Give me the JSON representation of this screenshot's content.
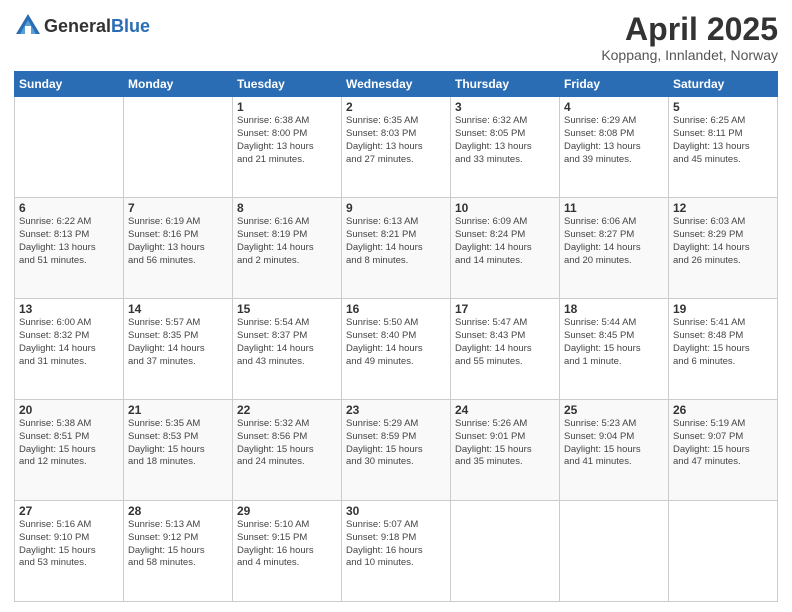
{
  "header": {
    "logo_general": "General",
    "logo_blue": "Blue",
    "title": "April 2025",
    "subtitle": "Koppang, Innlandet, Norway"
  },
  "days_of_week": [
    "Sunday",
    "Monday",
    "Tuesday",
    "Wednesday",
    "Thursday",
    "Friday",
    "Saturday"
  ],
  "weeks": [
    [
      {
        "day": "",
        "detail": ""
      },
      {
        "day": "",
        "detail": ""
      },
      {
        "day": "1",
        "detail": "Sunrise: 6:38 AM\nSunset: 8:00 PM\nDaylight: 13 hours\nand 21 minutes."
      },
      {
        "day": "2",
        "detail": "Sunrise: 6:35 AM\nSunset: 8:03 PM\nDaylight: 13 hours\nand 27 minutes."
      },
      {
        "day": "3",
        "detail": "Sunrise: 6:32 AM\nSunset: 8:05 PM\nDaylight: 13 hours\nand 33 minutes."
      },
      {
        "day": "4",
        "detail": "Sunrise: 6:29 AM\nSunset: 8:08 PM\nDaylight: 13 hours\nand 39 minutes."
      },
      {
        "day": "5",
        "detail": "Sunrise: 6:25 AM\nSunset: 8:11 PM\nDaylight: 13 hours\nand 45 minutes."
      }
    ],
    [
      {
        "day": "6",
        "detail": "Sunrise: 6:22 AM\nSunset: 8:13 PM\nDaylight: 13 hours\nand 51 minutes."
      },
      {
        "day": "7",
        "detail": "Sunrise: 6:19 AM\nSunset: 8:16 PM\nDaylight: 13 hours\nand 56 minutes."
      },
      {
        "day": "8",
        "detail": "Sunrise: 6:16 AM\nSunset: 8:19 PM\nDaylight: 14 hours\nand 2 minutes."
      },
      {
        "day": "9",
        "detail": "Sunrise: 6:13 AM\nSunset: 8:21 PM\nDaylight: 14 hours\nand 8 minutes."
      },
      {
        "day": "10",
        "detail": "Sunrise: 6:09 AM\nSunset: 8:24 PM\nDaylight: 14 hours\nand 14 minutes."
      },
      {
        "day": "11",
        "detail": "Sunrise: 6:06 AM\nSunset: 8:27 PM\nDaylight: 14 hours\nand 20 minutes."
      },
      {
        "day": "12",
        "detail": "Sunrise: 6:03 AM\nSunset: 8:29 PM\nDaylight: 14 hours\nand 26 minutes."
      }
    ],
    [
      {
        "day": "13",
        "detail": "Sunrise: 6:00 AM\nSunset: 8:32 PM\nDaylight: 14 hours\nand 31 minutes."
      },
      {
        "day": "14",
        "detail": "Sunrise: 5:57 AM\nSunset: 8:35 PM\nDaylight: 14 hours\nand 37 minutes."
      },
      {
        "day": "15",
        "detail": "Sunrise: 5:54 AM\nSunset: 8:37 PM\nDaylight: 14 hours\nand 43 minutes."
      },
      {
        "day": "16",
        "detail": "Sunrise: 5:50 AM\nSunset: 8:40 PM\nDaylight: 14 hours\nand 49 minutes."
      },
      {
        "day": "17",
        "detail": "Sunrise: 5:47 AM\nSunset: 8:43 PM\nDaylight: 14 hours\nand 55 minutes."
      },
      {
        "day": "18",
        "detail": "Sunrise: 5:44 AM\nSunset: 8:45 PM\nDaylight: 15 hours\nand 1 minute."
      },
      {
        "day": "19",
        "detail": "Sunrise: 5:41 AM\nSunset: 8:48 PM\nDaylight: 15 hours\nand 6 minutes."
      }
    ],
    [
      {
        "day": "20",
        "detail": "Sunrise: 5:38 AM\nSunset: 8:51 PM\nDaylight: 15 hours\nand 12 minutes."
      },
      {
        "day": "21",
        "detail": "Sunrise: 5:35 AM\nSunset: 8:53 PM\nDaylight: 15 hours\nand 18 minutes."
      },
      {
        "day": "22",
        "detail": "Sunrise: 5:32 AM\nSunset: 8:56 PM\nDaylight: 15 hours\nand 24 minutes."
      },
      {
        "day": "23",
        "detail": "Sunrise: 5:29 AM\nSunset: 8:59 PM\nDaylight: 15 hours\nand 30 minutes."
      },
      {
        "day": "24",
        "detail": "Sunrise: 5:26 AM\nSunset: 9:01 PM\nDaylight: 15 hours\nand 35 minutes."
      },
      {
        "day": "25",
        "detail": "Sunrise: 5:23 AM\nSunset: 9:04 PM\nDaylight: 15 hours\nand 41 minutes."
      },
      {
        "day": "26",
        "detail": "Sunrise: 5:19 AM\nSunset: 9:07 PM\nDaylight: 15 hours\nand 47 minutes."
      }
    ],
    [
      {
        "day": "27",
        "detail": "Sunrise: 5:16 AM\nSunset: 9:10 PM\nDaylight: 15 hours\nand 53 minutes."
      },
      {
        "day": "28",
        "detail": "Sunrise: 5:13 AM\nSunset: 9:12 PM\nDaylight: 15 hours\nand 58 minutes."
      },
      {
        "day": "29",
        "detail": "Sunrise: 5:10 AM\nSunset: 9:15 PM\nDaylight: 16 hours\nand 4 minutes."
      },
      {
        "day": "30",
        "detail": "Sunrise: 5:07 AM\nSunset: 9:18 PM\nDaylight: 16 hours\nand 10 minutes."
      },
      {
        "day": "",
        "detail": ""
      },
      {
        "day": "",
        "detail": ""
      },
      {
        "day": "",
        "detail": ""
      }
    ]
  ]
}
